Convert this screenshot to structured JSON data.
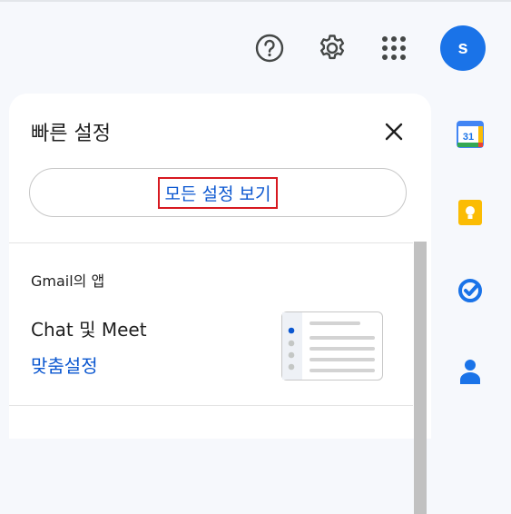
{
  "header": {
    "icons": [
      "help-icon",
      "settings-gear-icon",
      "google-apps-grid-icon"
    ],
    "avatar_initial": "s",
    "accent": "#1a73e8"
  },
  "quick_settings": {
    "title": "빠른 설정",
    "see_all_settings": "모든 설정 보기",
    "apps_section_heading": "Gmail의 앱",
    "chat_meet_label": "Chat 및 Meet",
    "customize_link": "맞춤설정",
    "link_color": "#0b57d0"
  },
  "side_panel": {
    "apps": [
      "calendar-icon",
      "keep-icon",
      "tasks-icon",
      "contacts-icon"
    ],
    "calendar_date": "31"
  }
}
